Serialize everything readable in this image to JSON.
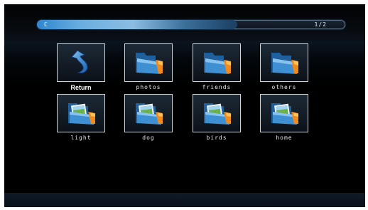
{
  "path_bar": {
    "path": "C",
    "page": "1/2",
    "progress_fraction": 0.65
  },
  "items": [
    {
      "label": "Return",
      "icon": "return-arrow-icon"
    },
    {
      "label": "photos",
      "icon": "folder-icon"
    },
    {
      "label": "friends",
      "icon": "folder-icon"
    },
    {
      "label": "others",
      "icon": "folder-icon"
    },
    {
      "label": "light",
      "icon": "photo-folder-icon"
    },
    {
      "label": "dog",
      "icon": "photo-folder-icon"
    },
    {
      "label": "birds",
      "icon": "photo-folder-icon"
    },
    {
      "label": "home",
      "icon": "photo-folder-icon"
    }
  ],
  "colors": {
    "background": "#000000",
    "accent": "#3a8fd8",
    "tile_border": "#cfd3d6",
    "folder_blue": "#3b86c6",
    "folder_orange": "#f08a1c"
  }
}
